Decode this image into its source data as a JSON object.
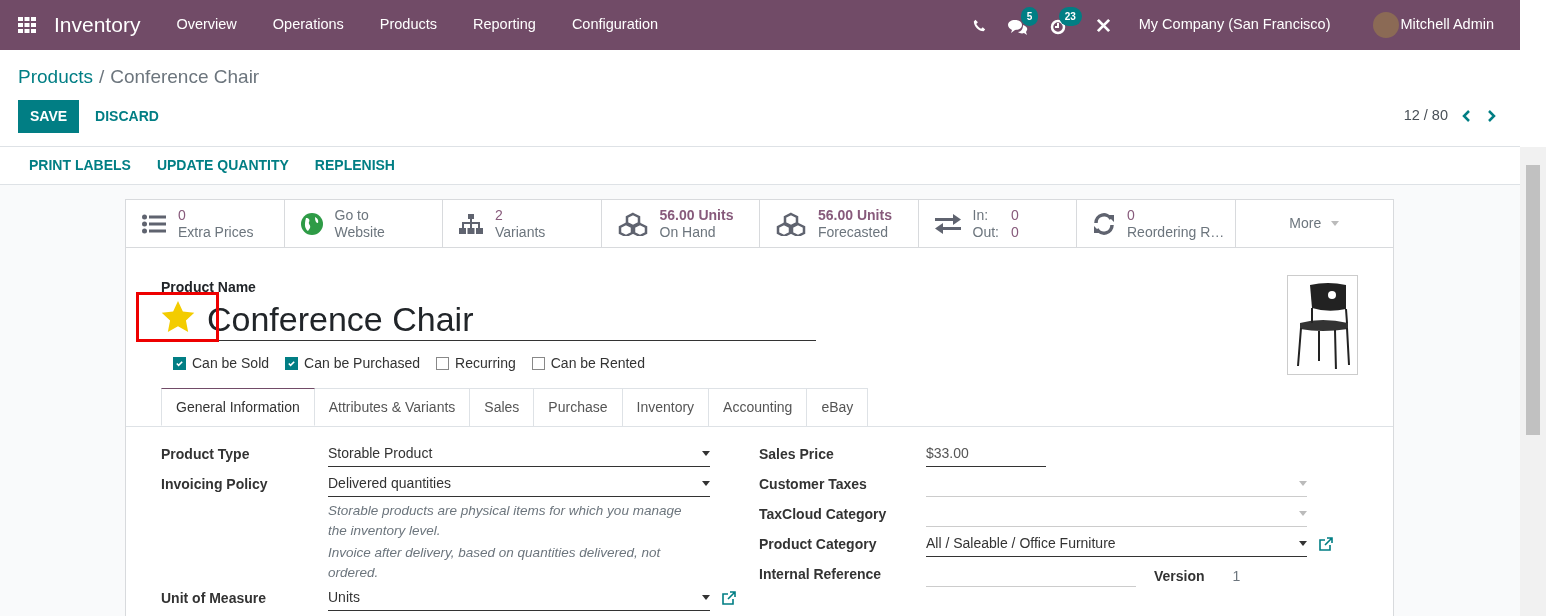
{
  "navbar": {
    "app": "Inventory",
    "menu": [
      "Overview",
      "Operations",
      "Products",
      "Reporting",
      "Configuration"
    ],
    "chat_count": "5",
    "activity_count": "23",
    "company": "My Company (San Francisco)",
    "user": "Mitchell Admin"
  },
  "breadcrumb": {
    "parent": "Products",
    "separator": "/",
    "current": "Conference Chair"
  },
  "buttons": [
    {
      "kind": "primary",
      "label": "SAVE"
    },
    {
      "kind": "link",
      "label": "DISCARD"
    }
  ],
  "pager": "12 / 80",
  "actions": [
    "PRINT LABELS",
    "UPDATE QUANTITY",
    "REPLENISH"
  ],
  "smart_buttons": [
    {
      "kind": "stat",
      "value": "0",
      "label": "Extra Prices"
    },
    {
      "kind": "text",
      "value": "Go to",
      "label": "Website"
    },
    {
      "kind": "stat",
      "value": "2",
      "label": "Variants"
    },
    {
      "kind": "bold",
      "value": "56.00 Units",
      "label": "On Hand"
    },
    {
      "kind": "bold",
      "value": "56.00 Units",
      "label": "Forecasted"
    },
    {
      "kind": "inout",
      "in_label": "In:",
      "in_value": "0",
      "out_label": "Out:",
      "out_value": "0"
    },
    {
      "kind": "stat",
      "value": "0",
      "label": "Reordering R…"
    },
    {
      "kind": "more",
      "label": "More"
    }
  ],
  "product": {
    "name_label": "Product Name",
    "name": "Conference Chair",
    "favorite": true
  },
  "checkboxes": [
    {
      "label": "Can be Sold",
      "checked": true
    },
    {
      "label": "Can be Purchased",
      "checked": true
    },
    {
      "label": "Recurring",
      "checked": false
    },
    {
      "label": "Can be Rented",
      "checked": false
    }
  ],
  "tabs": [
    {
      "label": "General Information",
      "selected": true
    },
    {
      "label": "Attributes & Variants",
      "selected": false
    },
    {
      "label": "Sales",
      "selected": false
    },
    {
      "label": "Purchase",
      "selected": false
    },
    {
      "label": "Inventory",
      "selected": false
    },
    {
      "label": "Accounting",
      "selected": false
    },
    {
      "label": "eBay",
      "selected": false
    }
  ],
  "left_fields": [
    {
      "kind": "select",
      "label": "Product Type",
      "value": "Storable Product"
    },
    {
      "kind": "select",
      "label": "Invoicing Policy",
      "value": "Delivered quantities"
    },
    {
      "kind": "help",
      "value": "Storable products are physical items for which you manage the inventory level."
    },
    {
      "kind": "help",
      "value": "Invoice after delivery, based on quantities delivered, not ordered."
    },
    {
      "kind": "link-select",
      "label": "Unit of Measure",
      "value": "Units"
    }
  ],
  "right_fields": [
    {
      "kind": "input",
      "label": "Sales Price",
      "value": "$33.00"
    },
    {
      "kind": "select",
      "label": "Customer Taxes"
    },
    {
      "kind": "select",
      "label": "TaxCloud Category"
    },
    {
      "kind": "link-select",
      "label": "Product Category",
      "value": "All / Saleable / Office Furniture"
    },
    {
      "kind": "version",
      "label": "Internal Reference",
      "version_label": "Version",
      "version": "1"
    }
  ]
}
